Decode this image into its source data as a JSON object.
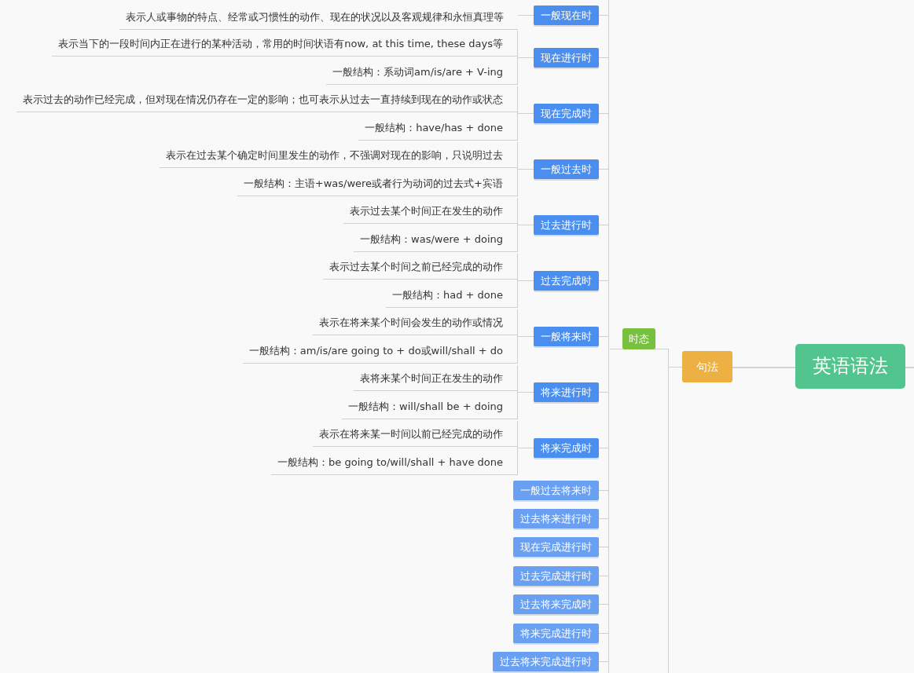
{
  "root": {
    "label": "英语语法"
  },
  "branch": {
    "label": "句法"
  },
  "topic": {
    "label": "时态"
  },
  "tenses": [
    {
      "label": "一般现在时",
      "color": "#4a8ff0",
      "notes": [
        "表示人或事物的特点、经常或习惯性的动作、现在的状况以及客观规律和永恒真理等"
      ]
    },
    {
      "label": "现在进行时",
      "color": "#4a8ff0",
      "notes": [
        "表示当下的一段时间内正在进行的某种活动，常用的时间状语有now, at this time, these days等",
        "一般结构：系动词am/is/are + V-ing"
      ]
    },
    {
      "label": "现在完成时",
      "color": "#4a8ff0",
      "notes": [
        "表示过去的动作已经完成，但对现在情况仍存在一定的影响；也可表示从过去一直持续到现在的动作或状态",
        "一般结构：have/has + done"
      ]
    },
    {
      "label": "一般过去时",
      "color": "#4a8ff0",
      "notes": [
        "表示在过去某个确定时间里发生的动作，不强调对现在的影响，只说明过去",
        "一般结构：主语+was/were或者行为动词的过去式+宾语"
      ]
    },
    {
      "label": "过去进行时",
      "color": "#4a8ff0",
      "notes": [
        "表示过去某个时间正在发生的动作",
        "一般结构：was/were + doing"
      ]
    },
    {
      "label": "过去完成时",
      "color": "#4a8ff0",
      "notes": [
        "表示过去某个时间之前已经完成的动作",
        "一般结构：had + done"
      ]
    },
    {
      "label": "一般将来时",
      "color": "#4a8ff0",
      "notes": [
        "表示在将来某个时间会发生的动作或情况",
        "一般结构：am/is/are going to + do或will/shall + do"
      ]
    },
    {
      "label": "将来进行时",
      "color": "#4a8ff0",
      "notes": [
        "表将来某个时间正在发生的动作",
        "一般结构：will/shall be + doing"
      ]
    },
    {
      "label": "将来完成时",
      "color": "#4a8ff0",
      "notes": [
        "表示在将来某一时间以前已经完成的动作",
        "一般结构：be going to/will/shall + have done"
      ]
    },
    {
      "label": "一般过去将来时",
      "color": "#6aa0f2"
    },
    {
      "label": "过去将来进行时",
      "color": "#6aa0f2"
    },
    {
      "label": "现在完成进行时",
      "color": "#6aa0f2"
    },
    {
      "label": "过去完成进行时",
      "color": "#6aa0f2"
    },
    {
      "label": "过去将来完成时",
      "color": "#6aa0f2"
    },
    {
      "label": "将来完成进行时",
      "color": "#6aa0f2"
    },
    {
      "label": "过去将来完成进行时",
      "color": "#6aa0f2"
    }
  ]
}
